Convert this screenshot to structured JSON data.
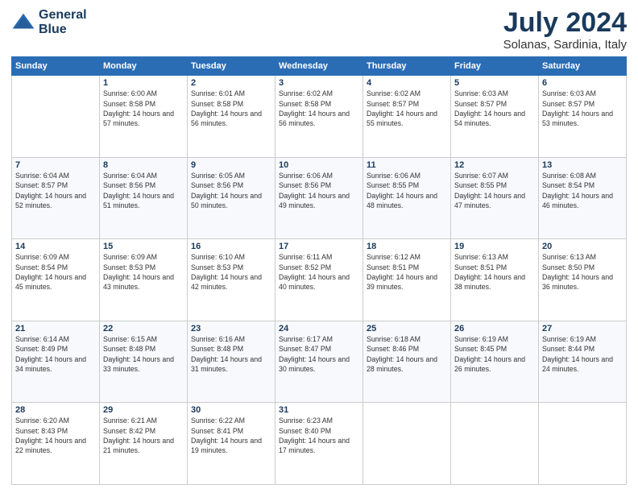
{
  "logo": {
    "line1": "General",
    "line2": "Blue"
  },
  "title": "July 2024",
  "subtitle": "Solanas, Sardinia, Italy",
  "weekdays": [
    "Sunday",
    "Monday",
    "Tuesday",
    "Wednesday",
    "Thursday",
    "Friday",
    "Saturday"
  ],
  "weeks": [
    [
      {
        "day": "",
        "sunrise": "",
        "sunset": "",
        "daylight": ""
      },
      {
        "day": "1",
        "sunrise": "Sunrise: 6:00 AM",
        "sunset": "Sunset: 8:58 PM",
        "daylight": "Daylight: 14 hours and 57 minutes."
      },
      {
        "day": "2",
        "sunrise": "Sunrise: 6:01 AM",
        "sunset": "Sunset: 8:58 PM",
        "daylight": "Daylight: 14 hours and 56 minutes."
      },
      {
        "day": "3",
        "sunrise": "Sunrise: 6:02 AM",
        "sunset": "Sunset: 8:58 PM",
        "daylight": "Daylight: 14 hours and 56 minutes."
      },
      {
        "day": "4",
        "sunrise": "Sunrise: 6:02 AM",
        "sunset": "Sunset: 8:57 PM",
        "daylight": "Daylight: 14 hours and 55 minutes."
      },
      {
        "day": "5",
        "sunrise": "Sunrise: 6:03 AM",
        "sunset": "Sunset: 8:57 PM",
        "daylight": "Daylight: 14 hours and 54 minutes."
      },
      {
        "day": "6",
        "sunrise": "Sunrise: 6:03 AM",
        "sunset": "Sunset: 8:57 PM",
        "daylight": "Daylight: 14 hours and 53 minutes."
      }
    ],
    [
      {
        "day": "7",
        "sunrise": "Sunrise: 6:04 AM",
        "sunset": "Sunset: 8:57 PM",
        "daylight": "Daylight: 14 hours and 52 minutes."
      },
      {
        "day": "8",
        "sunrise": "Sunrise: 6:04 AM",
        "sunset": "Sunset: 8:56 PM",
        "daylight": "Daylight: 14 hours and 51 minutes."
      },
      {
        "day": "9",
        "sunrise": "Sunrise: 6:05 AM",
        "sunset": "Sunset: 8:56 PM",
        "daylight": "Daylight: 14 hours and 50 minutes."
      },
      {
        "day": "10",
        "sunrise": "Sunrise: 6:06 AM",
        "sunset": "Sunset: 8:56 PM",
        "daylight": "Daylight: 14 hours and 49 minutes."
      },
      {
        "day": "11",
        "sunrise": "Sunrise: 6:06 AM",
        "sunset": "Sunset: 8:55 PM",
        "daylight": "Daylight: 14 hours and 48 minutes."
      },
      {
        "day": "12",
        "sunrise": "Sunrise: 6:07 AM",
        "sunset": "Sunset: 8:55 PM",
        "daylight": "Daylight: 14 hours and 47 minutes."
      },
      {
        "day": "13",
        "sunrise": "Sunrise: 6:08 AM",
        "sunset": "Sunset: 8:54 PM",
        "daylight": "Daylight: 14 hours and 46 minutes."
      }
    ],
    [
      {
        "day": "14",
        "sunrise": "Sunrise: 6:09 AM",
        "sunset": "Sunset: 8:54 PM",
        "daylight": "Daylight: 14 hours and 45 minutes."
      },
      {
        "day": "15",
        "sunrise": "Sunrise: 6:09 AM",
        "sunset": "Sunset: 8:53 PM",
        "daylight": "Daylight: 14 hours and 43 minutes."
      },
      {
        "day": "16",
        "sunrise": "Sunrise: 6:10 AM",
        "sunset": "Sunset: 8:53 PM",
        "daylight": "Daylight: 14 hours and 42 minutes."
      },
      {
        "day": "17",
        "sunrise": "Sunrise: 6:11 AM",
        "sunset": "Sunset: 8:52 PM",
        "daylight": "Daylight: 14 hours and 40 minutes."
      },
      {
        "day": "18",
        "sunrise": "Sunrise: 6:12 AM",
        "sunset": "Sunset: 8:51 PM",
        "daylight": "Daylight: 14 hours and 39 minutes."
      },
      {
        "day": "19",
        "sunrise": "Sunrise: 6:13 AM",
        "sunset": "Sunset: 8:51 PM",
        "daylight": "Daylight: 14 hours and 38 minutes."
      },
      {
        "day": "20",
        "sunrise": "Sunrise: 6:13 AM",
        "sunset": "Sunset: 8:50 PM",
        "daylight": "Daylight: 14 hours and 36 minutes."
      }
    ],
    [
      {
        "day": "21",
        "sunrise": "Sunrise: 6:14 AM",
        "sunset": "Sunset: 8:49 PM",
        "daylight": "Daylight: 14 hours and 34 minutes."
      },
      {
        "day": "22",
        "sunrise": "Sunrise: 6:15 AM",
        "sunset": "Sunset: 8:48 PM",
        "daylight": "Daylight: 14 hours and 33 minutes."
      },
      {
        "day": "23",
        "sunrise": "Sunrise: 6:16 AM",
        "sunset": "Sunset: 8:48 PM",
        "daylight": "Daylight: 14 hours and 31 minutes."
      },
      {
        "day": "24",
        "sunrise": "Sunrise: 6:17 AM",
        "sunset": "Sunset: 8:47 PM",
        "daylight": "Daylight: 14 hours and 30 minutes."
      },
      {
        "day": "25",
        "sunrise": "Sunrise: 6:18 AM",
        "sunset": "Sunset: 8:46 PM",
        "daylight": "Daylight: 14 hours and 28 minutes."
      },
      {
        "day": "26",
        "sunrise": "Sunrise: 6:19 AM",
        "sunset": "Sunset: 8:45 PM",
        "daylight": "Daylight: 14 hours and 26 minutes."
      },
      {
        "day": "27",
        "sunrise": "Sunrise: 6:19 AM",
        "sunset": "Sunset: 8:44 PM",
        "daylight": "Daylight: 14 hours and 24 minutes."
      }
    ],
    [
      {
        "day": "28",
        "sunrise": "Sunrise: 6:20 AM",
        "sunset": "Sunset: 8:43 PM",
        "daylight": "Daylight: 14 hours and 22 minutes."
      },
      {
        "day": "29",
        "sunrise": "Sunrise: 6:21 AM",
        "sunset": "Sunset: 8:42 PM",
        "daylight": "Daylight: 14 hours and 21 minutes."
      },
      {
        "day": "30",
        "sunrise": "Sunrise: 6:22 AM",
        "sunset": "Sunset: 8:41 PM",
        "daylight": "Daylight: 14 hours and 19 minutes."
      },
      {
        "day": "31",
        "sunrise": "Sunrise: 6:23 AM",
        "sunset": "Sunset: 8:40 PM",
        "daylight": "Daylight: 14 hours and 17 minutes."
      },
      {
        "day": "",
        "sunrise": "",
        "sunset": "",
        "daylight": ""
      },
      {
        "day": "",
        "sunrise": "",
        "sunset": "",
        "daylight": ""
      },
      {
        "day": "",
        "sunrise": "",
        "sunset": "",
        "daylight": ""
      }
    ]
  ]
}
